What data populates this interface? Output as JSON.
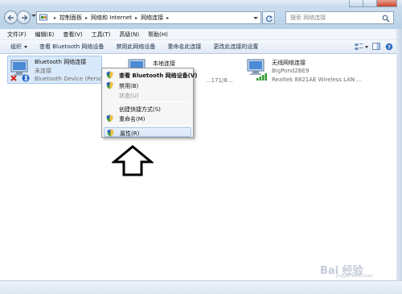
{
  "address_bar": {
    "crumbs": [
      "控制面板",
      "网络和 Internet",
      "网络连接"
    ],
    "search_placeholder": "搜索 网络连接"
  },
  "menubar": {
    "items": [
      "文件(F)",
      "编辑(E)",
      "查看(V)",
      "工具(T)",
      "高级(N)",
      "帮助(H)"
    ]
  },
  "toolbar": {
    "organize": "组织",
    "view_bt_device": "查看 Bluetooth 网络设备",
    "disable_device": "禁用此网络设备",
    "rename": "重命名此连接",
    "change_settings": "更改此连接的设置"
  },
  "connections": [
    {
      "name": "Bluetooth 网络连接",
      "status": "未连接",
      "device": "Bluetooth Device (Person..."
    },
    {
      "name": "本地连接",
      "status": "",
      "device": "...171/8..."
    },
    {
      "name": "无线网络连接",
      "status": "BigPond2BE9",
      "device": "Realtek 8821AE Wireless LAN ..."
    }
  ],
  "context_menu": {
    "items": [
      {
        "label": "查看 Bluetooth 网络设备(V)",
        "bold": true,
        "disabled": false,
        "shield": true
      },
      {
        "label": "禁用(B)",
        "bold": false,
        "disabled": false,
        "shield": true
      },
      {
        "label": "状态(U)",
        "bold": false,
        "disabled": true,
        "shield": false
      },
      {
        "label": "创建快捷方式(S)",
        "bold": false,
        "disabled": false,
        "shield": false
      },
      {
        "label": "重命名(M)",
        "bold": false,
        "disabled": false,
        "shield": true
      },
      {
        "label": "属性(R)",
        "bold": false,
        "disabled": false,
        "shield": true
      }
    ]
  },
  "watermark": {
    "text": "Bai 经验",
    "sub": "jingyan.baidu.com"
  },
  "colors": {
    "accent": "#3a78d6",
    "selection": "#d8e9fb",
    "titlebar": "#c4d8ec"
  }
}
